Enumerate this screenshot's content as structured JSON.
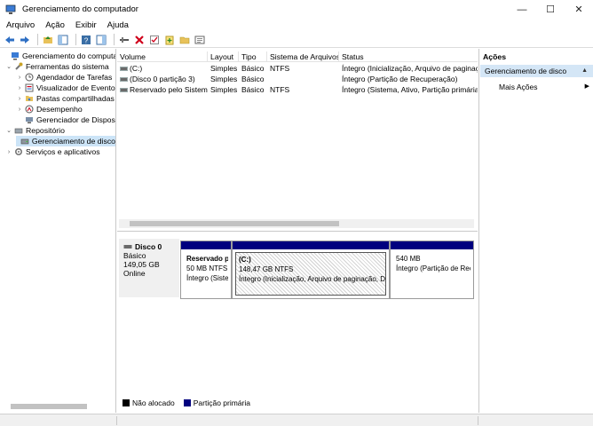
{
  "window": {
    "title": "Gerenciamento do computador",
    "minimize": "—",
    "maximize": "☐",
    "close": "✕"
  },
  "menu": [
    "Arquivo",
    "Ação",
    "Exibir",
    "Ajuda"
  ],
  "tree": [
    {
      "label": "Gerenciamento do computado",
      "arrow": "",
      "indent": 0
    },
    {
      "label": "Ferramentas do sistema",
      "arrow": "⌄",
      "indent": 1
    },
    {
      "label": "Agendador de Tarefas",
      "arrow": "›",
      "indent": 2
    },
    {
      "label": "Visualizador de Eventos",
      "arrow": "›",
      "indent": 2
    },
    {
      "label": "Pastas compartilhadas",
      "arrow": "›",
      "indent": 2
    },
    {
      "label": "Desempenho",
      "arrow": "›",
      "indent": 2
    },
    {
      "label": "Gerenciador de Disposit",
      "arrow": "",
      "indent": 2
    },
    {
      "label": "Repositório",
      "arrow": "⌄",
      "indent": 1
    },
    {
      "label": "Gerenciamento de disco",
      "arrow": "",
      "indent": 2
    },
    {
      "label": "Serviços e aplicativos",
      "arrow": "›",
      "indent": 1
    }
  ],
  "list": {
    "columns": [
      "Volume",
      "Layout",
      "Tipo",
      "Sistema de Arquivos",
      "Status"
    ],
    "rows": [
      [
        "(C:)",
        "Simples",
        "Básico",
        "NTFS",
        "Íntegro (Inicialização, Arquivo de paginaç"
      ],
      [
        "(Disco 0 partição 3)",
        "Simples",
        "Básico",
        "",
        "Íntegro (Partição de Recuperação)"
      ],
      [
        "Reservado pelo Sistema",
        "Simples",
        "Básico",
        "NTFS",
        "Íntegro (Sistema, Ativo, Partição primária)"
      ]
    ]
  },
  "disk": {
    "name": "Disco 0",
    "type": "Básico",
    "size": "149,05 GB",
    "state": "Online",
    "partitions": [
      {
        "name": "Reservado p",
        "size": "50 MB NTFS",
        "status": "Íntegro (Siste"
      },
      {
        "name": "(C:)",
        "size": "148,47 GB NTFS",
        "status": "Íntegro (Inicialização, Arquivo de paginação, D"
      },
      {
        "name": "",
        "size": "540 MB",
        "status": "Íntegro (Partição de Rec"
      }
    ]
  },
  "legend": {
    "unallocated": "Não alocado",
    "primary": "Partição primária"
  },
  "actions": {
    "title": "Ações",
    "section": "Gerenciamento de disco",
    "more": "Mais Ações"
  },
  "colors": {
    "primary_partition": "#00007f",
    "unallocated": "#000000",
    "selection": "#cce4f7"
  }
}
